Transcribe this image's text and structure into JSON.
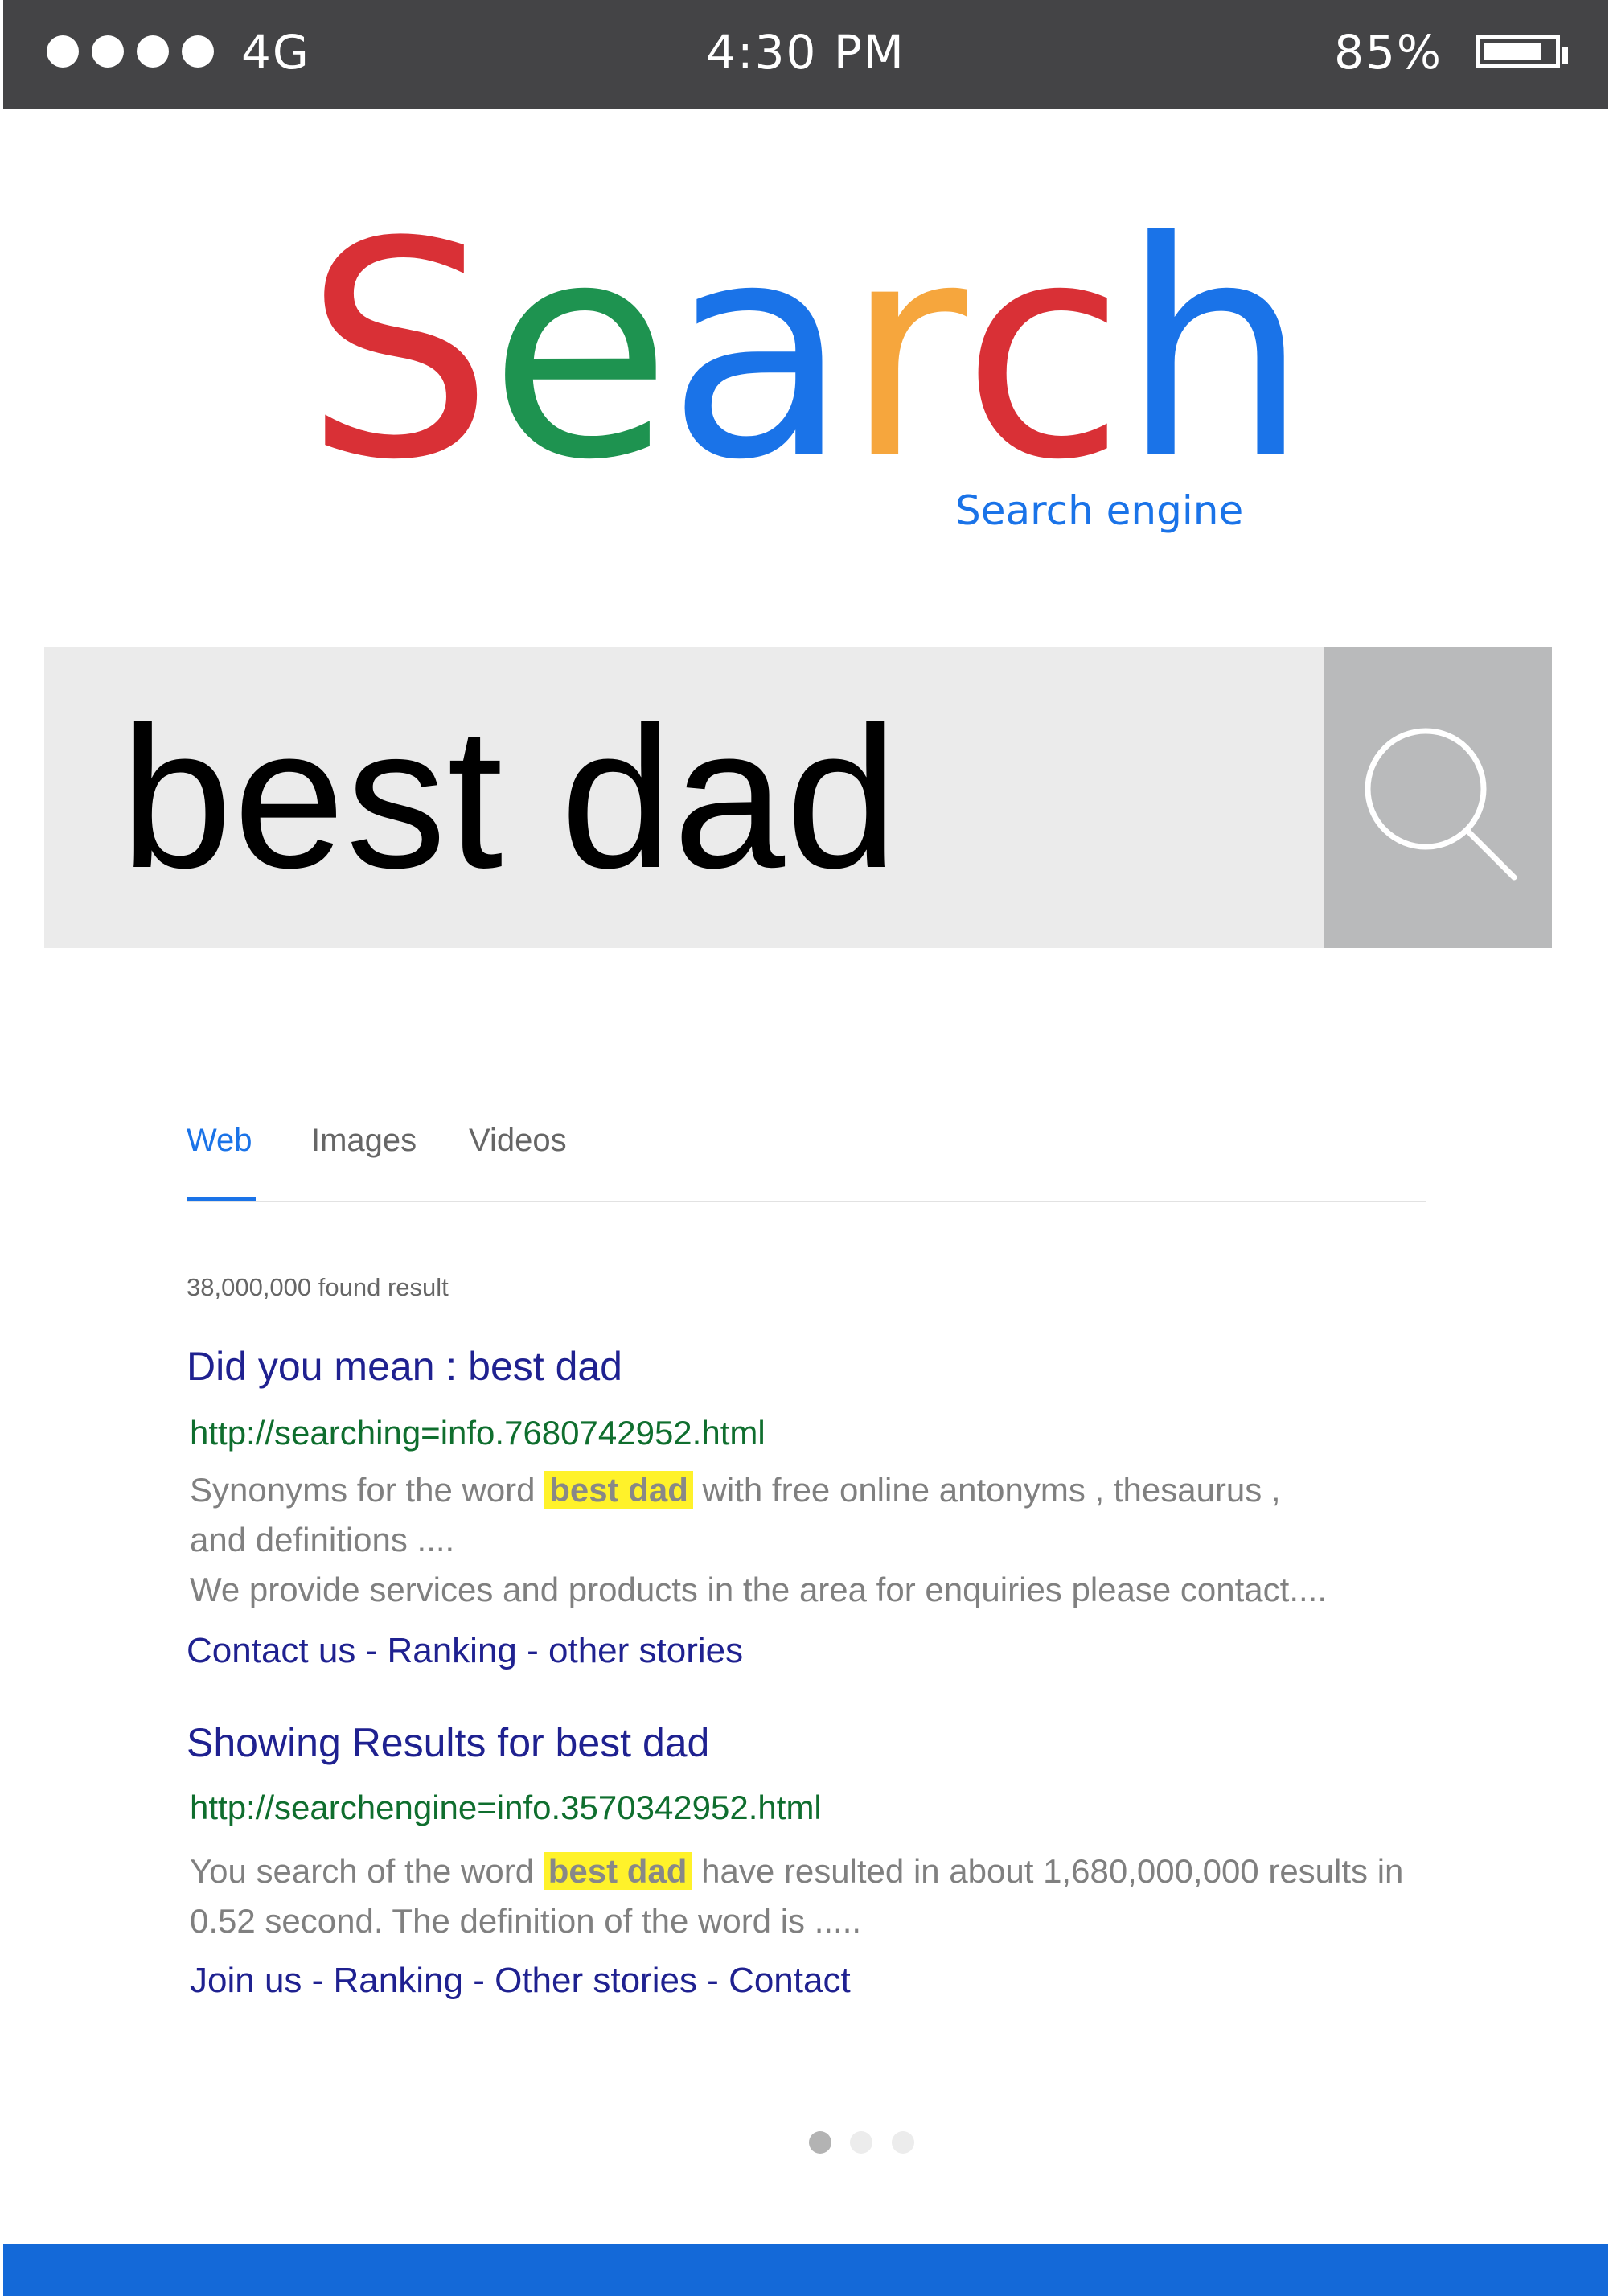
{
  "status_bar": {
    "network": "4G",
    "time": "4:30 PM",
    "battery_percent": "85%",
    "battery_level": 0.85,
    "signal_dots": 4
  },
  "logo": {
    "letters": [
      {
        "char": "S",
        "color": "#d93036"
      },
      {
        "char": "e",
        "color": "#1e9350"
      },
      {
        "char": "a",
        "color": "#1a73e8"
      },
      {
        "char": "r",
        "color": "#f6a63d"
      },
      {
        "char": "c",
        "color": "#d93036"
      },
      {
        "char": "h",
        "color": "#1a73e8"
      }
    ],
    "tagline": "Search engine"
  },
  "search": {
    "query": "best dad",
    "button_icon": "magnifier-icon"
  },
  "tabs": [
    {
      "label": "Web",
      "active": true
    },
    {
      "label": "Images",
      "active": false
    },
    {
      "label": "Videos",
      "active": false
    }
  ],
  "results_count": "38,000,000 found result",
  "results": [
    {
      "title": "Did you mean : best dad",
      "url": "http://searching=info.7680742952.html",
      "snippet_line1_pre": "Synonyms for the word ",
      "snippet_line1_highlight": "best dad",
      "snippet_line1_post": " with free online antonyms , thesaurus ,",
      "snippet_line2": "and definitions ....",
      "snippet_line3": "We provide services and products in the area for enquiries please contact....",
      "links": [
        "Contact us",
        "Ranking",
        "other stories"
      ]
    },
    {
      "title": "Showing Results for best dad",
      "url": "http://searchengine=info.3570342952.html",
      "snippet_line1_pre": "You search of the word ",
      "snippet_line1_highlight": "best dad",
      "snippet_line1_post": " have resulted in about 1,680,000,000 results in",
      "snippet_line2": "0.52 second. The definition of the word is .....",
      "links": [
        "Join us",
        "Ranking",
        "Other stories",
        "Contact"
      ]
    }
  ],
  "pagination": {
    "pages": 3,
    "current": 1
  },
  "colors": {
    "status_bar": "#444446",
    "accent_blue": "#1a73e8",
    "link": "#1f2190",
    "url": "#0f6e2e",
    "highlight": "#fff22a",
    "bottom_bar": "#1469d8"
  }
}
